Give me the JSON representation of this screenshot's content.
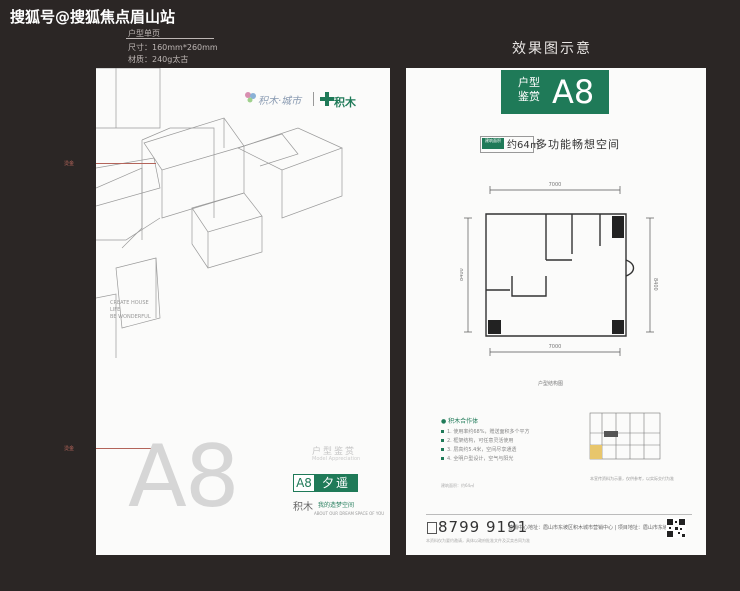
{
  "header": {
    "watermark": "搜狐号@搜狐焦点眉山站",
    "spec_title": "户型单页",
    "spec_size": "尺寸：160mm*260mm",
    "spec_material": "材质：240g太古",
    "right_title": "效果图示意"
  },
  "left_page": {
    "red_label_1": "烫金",
    "red_label_2": "烫金",
    "brand_1": "积木·城市",
    "brand_2": "积木",
    "vertical_text": [
      "CREATE HOUSE",
      "LIFE",
      "BE WONDERFUL"
    ],
    "big_title": "A8",
    "tag": "户型鉴赏",
    "tag_sub": "Model Appreciation",
    "badge_code": "A8",
    "badge_name": "夕遥",
    "footer_brand": "积木",
    "footer_slogan": "我的造梦空间",
    "footer_sub": "ABOUT OUR DREAM SPACE OF YOU"
  },
  "right_page": {
    "header_small": "户型鉴赏",
    "header_code": "A8",
    "sub_tag": "建筑面积",
    "area": "约64㎡",
    "sub_title": "多功能畅想空间",
    "dim_top": "7000",
    "dim_bottom": "7000",
    "dim_left": "8400",
    "dim_right": "8400",
    "plan_caption": "户型结构图",
    "legend_title": "● 积木合作体",
    "legend_items": [
      "1. 使用率约68%，赠送面积多个平方",
      "2. 框架结构，可任意灵活使用",
      "3. 层高约5.4米，空间尽享通透",
      "4. 全明户型设计，空气与阳光"
    ],
    "legend_foot": "建筑面积：约64㎡",
    "key_note": "本宣传资料为示意，仅供参考，以实际交付为准",
    "phone": "8799 9191",
    "address": "营销中心地址：眉山市东坡区积木城市营销中心  |  项目地址：眉山市东坡区",
    "footer_sub": "本资料仅为要约邀请，具体以政府批准文件及买卖合同为准"
  },
  "colors": {
    "background": "#2b2625",
    "brand_green": "#1f7a58",
    "page": "#fbfbfa",
    "annotation_red": "#b3645a"
  }
}
